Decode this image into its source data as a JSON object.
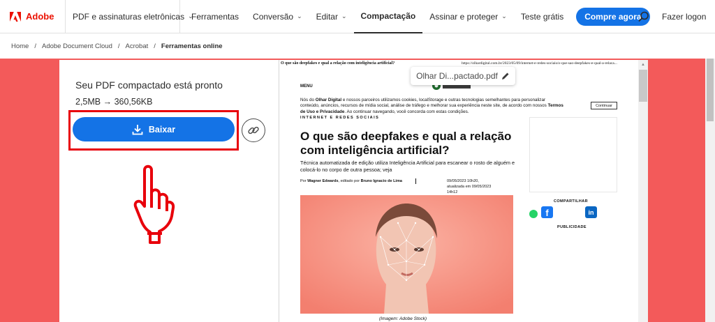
{
  "nav": {
    "brand": "Adobe",
    "products_menu": "PDF e assinaturas eletrônicas",
    "items": [
      {
        "label": "Ferramentas",
        "dropdown": false
      },
      {
        "label": "Conversão",
        "dropdown": true
      },
      {
        "label": "Editar",
        "dropdown": true
      },
      {
        "label": "Compactação",
        "dropdown": false,
        "active": true
      },
      {
        "label": "Assinar e proteger",
        "dropdown": true
      },
      {
        "label": "Teste grátis",
        "dropdown": false
      }
    ],
    "cta": "Compre agora",
    "search_icon": "search-icon",
    "login": "Fazer logon"
  },
  "breadcrumb": [
    "Home",
    "Adobe Document Cloud",
    "Acrobat",
    "Ferramentas online"
  ],
  "result": {
    "title": "Seu PDF compactado está pronto",
    "size": "2,5MB → 360,56KB",
    "download_label": "Baixar",
    "download_icon": "download-icon",
    "link_icon": "link-icon"
  },
  "annotation": {
    "pointer_icon": "pointing-hand-icon",
    "highlight_color": "#e8000b"
  },
  "preview": {
    "header_left": "O que são deepfakes e qual a relação com inteligência artificial?",
    "header_right": "https://olhardigital.com.br/2023/05/09/internet-e-redes-sociais/o-que-sao-deepfakes-e-qual-a-relaca...",
    "filename": "Olhar Di...pactado.pdf",
    "menu": "MENU",
    "cookie_parts": [
      "Nós do ",
      "Olhar Digital",
      " e nossos parceiros utilizamos cookies, localStorage e outras tecnologias semelhantes para personalizar conteúdo, anúncios, recursos de mídia social, análise de tráfego e melhorar sua experiência neste site, de acordo com nossos ",
      "Termos de Uso e Privacidade",
      ". Ao continuar navegando, você concorda com estas condições."
    ],
    "continue": "Continuar",
    "section": "INTERNET E REDES SOCIAIS",
    "headline": "O que são deepfakes e qual a relação com inteligência artificial?",
    "lede": "Técnica automatizada de edição utiliza Inteligência Artificial para escanear o rosto de alguém e colocá-lo no corpo de outra pessoa; veja",
    "byline_parts": [
      "Por ",
      "Wagner Edwards",
      ", editado por ",
      "Bruno Ignacio de Lima"
    ],
    "date": "09/05/2023 10h20, atualizada em 09/05/2023 14h12",
    "caption": "(Imagem: Adobe Stock)",
    "share_label": "COMPARTILHAR",
    "publicity_label": "PUBLICIDADE",
    "facebook": "f",
    "linkedin": "in",
    "scroll_up": "▲"
  },
  "colors": {
    "adobe_red": "#eb1000",
    "background_coral": "#f35a5a",
    "primary_blue": "#1473e6"
  }
}
